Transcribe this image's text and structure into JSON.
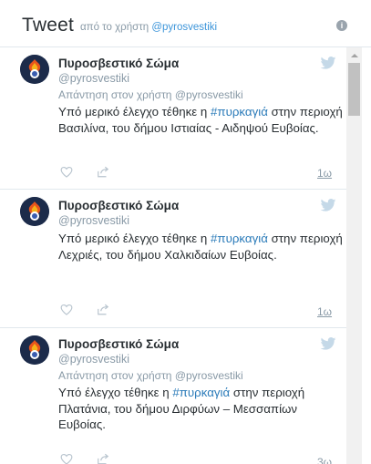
{
  "header": {
    "title": "Tweet",
    "by_prefix": "από το χρήστη",
    "by_handle": "@pyrosvestiki",
    "info_glyph": "i"
  },
  "icons": {
    "bird": "twitter-bird-icon",
    "heart": "heart-icon",
    "share": "share-icon",
    "info": "info-icon"
  },
  "colors": {
    "link": "#2b7bb9",
    "muted": "#8899a6",
    "text": "#292f33"
  },
  "tweets": [
    {
      "name": "Πυροσβεστικό Σώμα",
      "handle": "@pyrosvestiki",
      "reply": "Απάντηση στον χρήστη @pyrosvestiki",
      "text_pre": "Υπό μερικό έλεγχο τέθηκε η ",
      "hashtag": "#πυρκαγιά",
      "text_post": " στην περιοχή Βασιλίνα, του δήμου Ιστιαίας - Αιδηψού Ευβοίας.",
      "time": "1ω"
    },
    {
      "name": "Πυροσβεστικό Σώμα",
      "handle": "@pyrosvestiki",
      "reply": "",
      "text_pre": "Υπό μερικό έλεγχο τέθηκε η ",
      "hashtag": "#πυρκαγιά",
      "text_post": " στην περιοχή Λεχριές, του δήμου Χαλκιδαίων Ευβοίας.",
      "time": "1ω"
    },
    {
      "name": "Πυροσβεστικό Σώμα",
      "handle": "@pyrosvestiki",
      "reply": "Απάντηση στον χρήστη @pyrosvestiki",
      "text_pre": "Υπό έλεγχο τέθηκε η ",
      "hashtag": "#πυρκαγιά",
      "text_post": " στην περιοχή Πλατάνια, του δήμου Διρφύων – Μεσσαπίων Ευβοίας.",
      "time": "3ω"
    }
  ]
}
